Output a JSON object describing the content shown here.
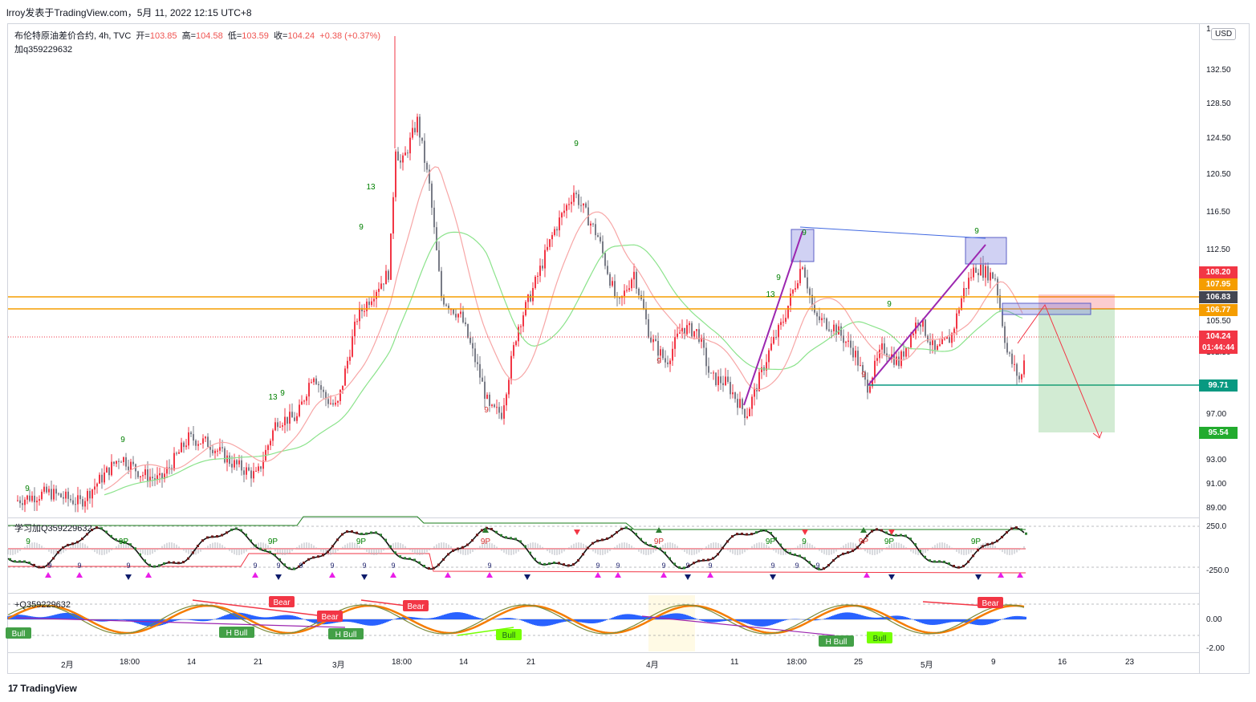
{
  "header": {
    "title": "lrroy发表于TradingView.com，5月 11, 2022 12:15 UTC+8"
  },
  "legend": {
    "symbol": "布伦特原油差价合约, 4h, TVC",
    "open_label": "开=",
    "open": "103.85",
    "high_label": "高=",
    "high": "104.58",
    "low_label": "低=",
    "low": "103.59",
    "close_label": "收=",
    "close": "104.24",
    "change": "+0.38 (+0.37%)",
    "note": "加q359229632"
  },
  "currency": "USD",
  "price_axis": {
    "ticks": [
      "132.50",
      "128.50",
      "124.50",
      "120.50",
      "116.50",
      "112.50",
      "105.50",
      "102.50",
      "97.00",
      "95.00",
      "93.00",
      "91.00",
      "89.00"
    ],
    "top_partial": "1"
  },
  "price_labels": [
    {
      "text": "108.20",
      "color": "#f23645"
    },
    {
      "text": "107.95",
      "color": "#f59d00"
    },
    {
      "text": "106.83",
      "color": "#434651"
    },
    {
      "text": "106.77",
      "color": "#f59d00"
    },
    {
      "text": "104.24",
      "color": "#f23645"
    },
    {
      "text": "01:44:44",
      "color": "#f23645"
    },
    {
      "text": "99.71",
      "color": "#089981"
    },
    {
      "text": "95.54",
      "color": "#22ab2e"
    }
  ],
  "time_axis": [
    "2月",
    "18:00",
    "14",
    "21",
    "3月",
    "18:00",
    "14",
    "21",
    "4月",
    "11",
    "18:00",
    "25",
    "5月",
    "9",
    "16",
    "23"
  ],
  "indicator1": {
    "title": "学习加Q359229632",
    "ticks": [
      "250.0",
      "-250.0"
    ],
    "labels": [
      "9",
      "9P",
      "9P",
      "9P",
      "9P",
      "9P",
      "9P",
      "9",
      "9P",
      "9P",
      "9P"
    ],
    "small_labels": [
      "9",
      "9",
      "9",
      "9",
      "9",
      "9",
      "9",
      "9",
      "9",
      "9",
      "9",
      "9",
      "9",
      "9",
      "9",
      "9",
      "9",
      "9"
    ]
  },
  "indicator2": {
    "title": "+Q359229632",
    "ticks": [
      "0.00",
      "-2.00"
    ],
    "signals": [
      "Bull",
      "H Bull",
      "H Bull",
      "Bull",
      "H Bull",
      "Bull",
      "Bear",
      "Bear",
      "Bear",
      "Bear"
    ]
  },
  "chart_marks": {
    "td_labels": [
      "9",
      "9",
      "13",
      "9",
      "13",
      "9",
      "9",
      "9",
      "9",
      "13",
      "9",
      "9",
      "9",
      "9"
    ]
  },
  "footer": {
    "brand": "TradingView",
    "logo": "17"
  },
  "colors": {
    "up": "#f23645",
    "down": "#787b86",
    "ma_fast": "#f7a6a6",
    "ma_slow": "#8be38b",
    "resistance": "#f59d00",
    "support": "#089981",
    "pattern": "#9c27b0"
  }
}
